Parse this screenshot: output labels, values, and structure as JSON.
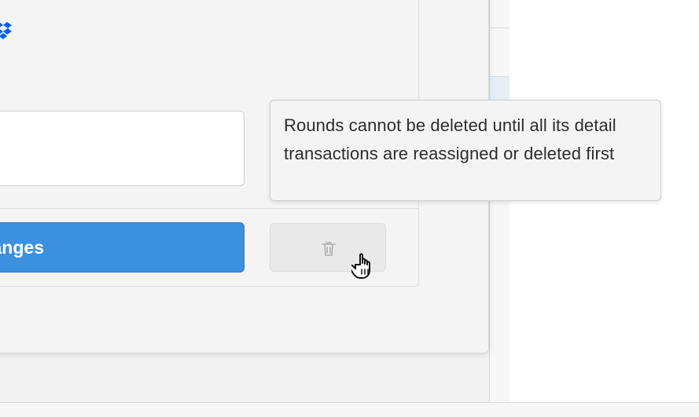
{
  "window": {
    "title": ""
  },
  "form": {
    "name_input_value": "",
    "save_button_label": "Save Changes"
  },
  "actions": {
    "delete_icon": "trash-icon"
  },
  "tooltip": {
    "text": "Rounds cannot be deleted until all its detail transactions are reassigned or deleted first"
  },
  "colors": {
    "accent": "#3b91df",
    "brand_blue": "#0061ff"
  },
  "icons": {
    "brand": "dropbox-icon",
    "cursor": "hand-pointer-icon"
  }
}
